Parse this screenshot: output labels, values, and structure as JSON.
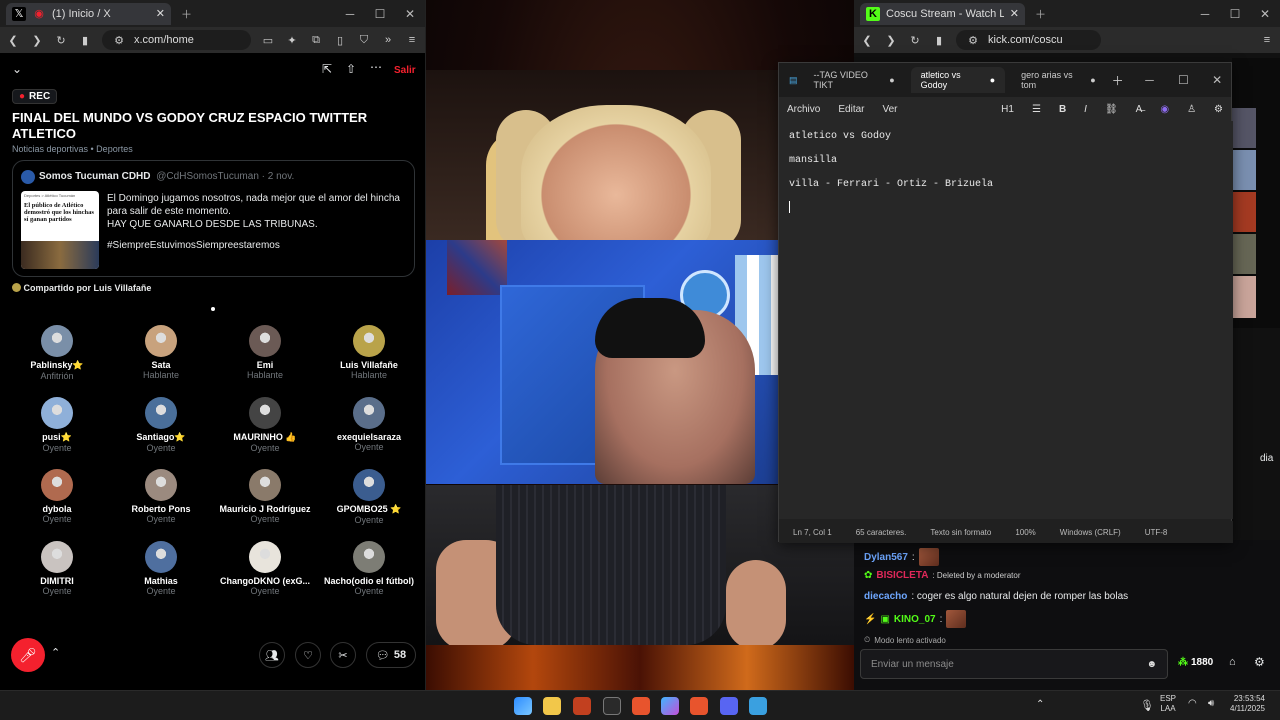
{
  "left_browser": {
    "tab_title": "(1) Inicio / X",
    "url": "x.com/home",
    "space": {
      "rec_label": "REC",
      "title": "FINAL DEL MUNDO VS GODOY CRUZ ESPACIO TWITTER ATLETICO",
      "category": "Noticias deportivas • Deportes",
      "exit_label": "Salir",
      "pinned_post": {
        "author": "Somos Tucuman CDHD",
        "handle": "@CdHSomosTucuman · 2 nov.",
        "text1": "El Domingo jugamos nosotros, nada mejor que el amor del hincha",
        "text2": "para salir de este momento.",
        "text3": "HAY QUE GANARLO DESDE LAS TRIBUNAS.",
        "hashtag": "#SiempreEstuvimosSiempreestaremos",
        "thumb_crumb": "Deportes > Atlético Tucumán",
        "thumb_headline": "El público de Atlético demostró que los hinchas sí ganan partidos"
      },
      "shared_by": "Compartido por Luis Villafañe",
      "participants": [
        {
          "name": "Pablinsky⭐",
          "role": "Anfitrión",
          "color": "#7a8fa8"
        },
        {
          "name": "Sata",
          "role": "Hablante",
          "color": "#c8a27d"
        },
        {
          "name": "Emi",
          "role": "Hablante",
          "color": "#6b5a55"
        },
        {
          "name": "Luis Villafañe",
          "role": "Hablante",
          "color": "#b9a34a"
        },
        {
          "name": "pusi⭐",
          "role": "Oyente",
          "color": "#8fb0d9"
        },
        {
          "name": "Santiago⭐",
          "role": "Oyente",
          "color": "#4a6f9a"
        },
        {
          "name": "MAURINHO 👍",
          "role": "Oyente",
          "color": "#444"
        },
        {
          "name": "exequielsaraza",
          "role": "Oyente",
          "color": "#5a6e8a"
        },
        {
          "name": "dybola",
          "role": "Oyente",
          "color": "#b06a4f"
        },
        {
          "name": "Roberto Pons",
          "role": "Oyente",
          "color": "#9b8a7f"
        },
        {
          "name": "Mauricio J Rodríguez",
          "role": "Oyente",
          "color": "#8a7a6a"
        },
        {
          "name": "GPOMBO25 ⭐",
          "role": "Oyente",
          "color": "#3b5d8f"
        },
        {
          "name": "DIMITRI",
          "role": "Oyente",
          "color": "#c9c3c0"
        },
        {
          "name": "Mathias",
          "role": "Oyente",
          "color": "#4f6f9f"
        },
        {
          "name": "ChangoDKNO (exG...",
          "role": "Oyente",
          "color": "#e8e4dc"
        },
        {
          "name": "Nacho(odio el fútbol)",
          "role": "Oyente",
          "color": "#7d7d75"
        }
      ],
      "comment_count": "58"
    }
  },
  "right_browser": {
    "tab_title": "Coscu Stream - Watch Live on Ki",
    "url": "kick.com/coscu",
    "side_text": "dia",
    "chat": {
      "lines": [
        {
          "user": "Dylan567",
          "text": ":",
          "color": "#6ea7ff"
        },
        {
          "user": "BISICLETA",
          "text": ": Deleted by a moderator",
          "color": "#e0285a"
        },
        {
          "user": "diecacho",
          "text": ": coger es algo natural dejen de romper las bolas",
          "color": "#6ea7ff"
        },
        {
          "user": "KINO_07",
          "text": ":",
          "color": "#53fc18"
        }
      ],
      "slow_mode": "Modo lento activado",
      "input_placeholder": "Enviar un mensaje",
      "points": "1880"
    }
  },
  "notepad": {
    "tabs": [
      "--TAG VIDEO TIKT",
      "atletico vs Godoy",
      "gero arias vs tom"
    ],
    "menu": [
      "Archivo",
      "Editar",
      "Ver"
    ],
    "heading_select": "H1",
    "lines": [
      "atletico vs Godoy",
      "mansilla",
      "villa - Ferrari - Ortiz - Brizuela"
    ],
    "status": {
      "position": "Ln 7, Col 1",
      "chars": "65 caracteres.",
      "format": "Texto sin formato",
      "zoom": "100%",
      "eol": "Windows (CRLF)",
      "encoding": "UTF-8"
    }
  },
  "taskbar": {
    "lang": "ESP",
    "lang2": "LAA",
    "time": "23:53:54",
    "date": "4/11/2025"
  }
}
